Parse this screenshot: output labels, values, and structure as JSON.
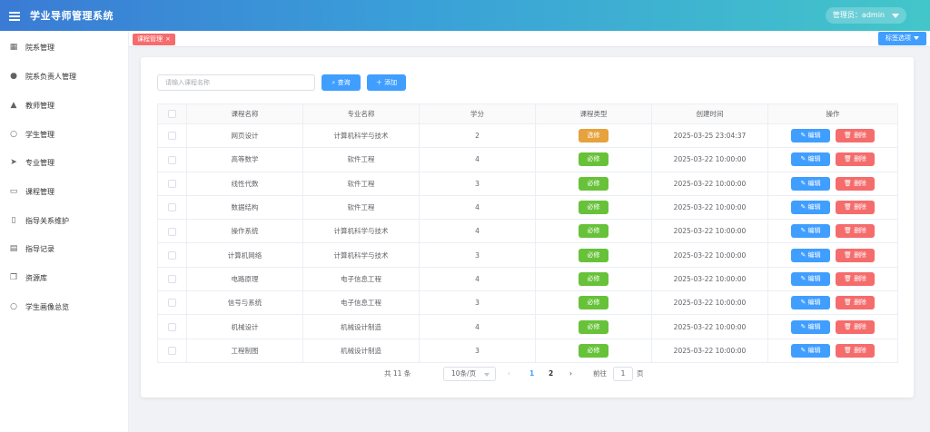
{
  "header": {
    "app_title": "学业导师管理系统",
    "admin_label": "管理员：admin"
  },
  "sidebar": {
    "items": [
      {
        "label": "院系管理",
        "icon": "building-icon"
      },
      {
        "label": "院系负责人管理",
        "icon": "user-fill-icon"
      },
      {
        "label": "教师管理",
        "icon": "teacher-icon"
      },
      {
        "label": "学生管理",
        "icon": "user-outline-icon"
      },
      {
        "label": "专业管理",
        "icon": "navigation-icon"
      },
      {
        "label": "课程管理",
        "icon": "folder-icon"
      },
      {
        "label": "指导关系维护",
        "icon": "bookmark-icon"
      },
      {
        "label": "指导记录",
        "icon": "message-icon"
      },
      {
        "label": "资源库",
        "icon": "copy-icon"
      },
      {
        "label": "学生画像总览",
        "icon": "user-outline-icon"
      }
    ]
  },
  "tagsbar": {
    "active_tag": "课程管理",
    "close_symbol": "×",
    "options_label": "标签选项"
  },
  "toolbar": {
    "search_placeholder": "请输入课程名称",
    "query_label": "查询",
    "add_label": "添加"
  },
  "table": {
    "headers": [
      "课程名称",
      "专业名称",
      "学分",
      "课程类型",
      "创建时间",
      "操作"
    ],
    "edit_label": "编辑",
    "delete_label": "删除",
    "rows": [
      {
        "name": "网页设计",
        "major": "计算机科学与技术",
        "credit": "2",
        "type": "选修",
        "created": "2025-03-25 23:04:37"
      },
      {
        "name": "高等数学",
        "major": "软件工程",
        "credit": "4",
        "type": "必修",
        "created": "2025-03-22 10:00:00"
      },
      {
        "name": "线性代数",
        "major": "软件工程",
        "credit": "3",
        "type": "必修",
        "created": "2025-03-22 10:00:00"
      },
      {
        "name": "数据结构",
        "major": "软件工程",
        "credit": "4",
        "type": "必修",
        "created": "2025-03-22 10:00:00"
      },
      {
        "name": "操作系统",
        "major": "计算机科学与技术",
        "credit": "4",
        "type": "必修",
        "created": "2025-03-22 10:00:00"
      },
      {
        "name": "计算机网络",
        "major": "计算机科学与技术",
        "credit": "3",
        "type": "必修",
        "created": "2025-03-22 10:00:00"
      },
      {
        "name": "电路原理",
        "major": "电子信息工程",
        "credit": "4",
        "type": "必修",
        "created": "2025-03-22 10:00:00"
      },
      {
        "name": "信号与系统",
        "major": "电子信息工程",
        "credit": "3",
        "type": "必修",
        "created": "2025-03-22 10:00:00"
      },
      {
        "name": "机械设计",
        "major": "机械设计制造",
        "credit": "4",
        "type": "必修",
        "created": "2025-03-22 10:00:00"
      },
      {
        "name": "工程制图",
        "major": "机械设计制造",
        "credit": "3",
        "type": "必修",
        "created": "2025-03-22 10:00:00"
      }
    ]
  },
  "colors": {
    "elective": "#e6a23c",
    "required": "#67c23a"
  },
  "pagination": {
    "total": "共 11 条",
    "page_size": "10条/页",
    "prev": "‹",
    "page1": "1",
    "page2": "2",
    "next": "›",
    "goto": "前往",
    "current": "1",
    "unit": "页"
  }
}
